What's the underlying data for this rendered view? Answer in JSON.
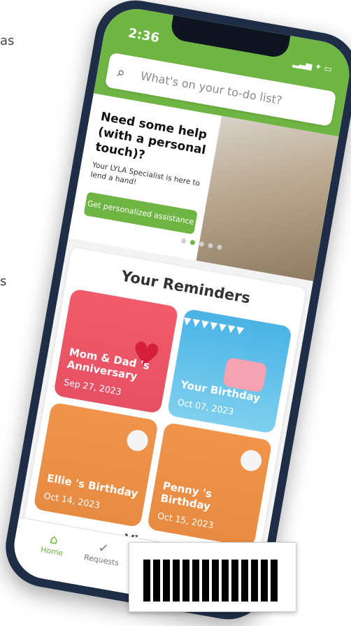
{
  "edge_text": {
    "top_fragment": "as",
    "left_fragment": "s"
  },
  "phone": {
    "status_time": "2:36",
    "status_icons": "signal wifi battery",
    "search": {
      "placeholder": "What's on your to-do list?",
      "icon": "search-icon"
    },
    "promo": {
      "title": "Need some help (with a personal touch)?",
      "subtitle": "Your LYLA Specialist is here to lend a hand!",
      "button_label": "Get personalized assistance",
      "dots": {
        "active_index": 1,
        "count": 5
      }
    },
    "reminders": {
      "title": "Your Reminders",
      "cards": [
        {
          "name": "Mom & Dad 's Anniversary",
          "date": "Sep 27, 2023",
          "color": "#ee5869"
        },
        {
          "name": "Your Birthday",
          "date": "Oct 07, 2023",
          "color": "#5bbfe8"
        },
        {
          "name": "Ellie 's Birthday",
          "date": "Oct 14, 2023",
          "color": "#ef924a"
        },
        {
          "name": "Penny 's Birthday",
          "date": "Oct 15, 2023",
          "color": "#ef924a"
        }
      ],
      "view_all_label": "View"
    },
    "tabbar": {
      "home_label": "Home",
      "requests_label": "Requests"
    }
  }
}
